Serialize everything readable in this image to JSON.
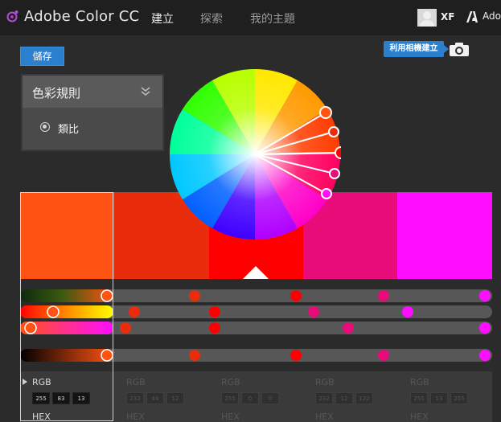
{
  "app": {
    "title": "Adobe Color CC"
  },
  "nav": {
    "create": "建立",
    "explore": "探索",
    "my_themes": "我的主題"
  },
  "user": {
    "name": "XF",
    "adobe_label": "Adobe"
  },
  "toolbar": {
    "save_label": "儲存",
    "camera_tip": "利用相機建立"
  },
  "rules": {
    "title": "色彩規則",
    "option": "類比"
  },
  "swatches": [
    {
      "color": "#FF5313",
      "rgb": [
        "255",
        "83",
        "13"
      ],
      "hex_label": "HEX",
      "rgb_label": "RGB"
    },
    {
      "color": "#E82C0C",
      "rgb": [
        "232",
        "44",
        "12"
      ],
      "hex_label": "HEX",
      "rgb_label": "RGB"
    },
    {
      "color": "#FF0000",
      "rgb": [
        "255",
        "0",
        "0"
      ],
      "hex_label": "HEX",
      "rgb_label": "RGB"
    },
    {
      "color": "#E80C7A",
      "rgb": [
        "232",
        "12",
        "122"
      ],
      "hex_label": "HEX",
      "rgb_label": "RGB"
    },
    {
      "color": "#FF0DFF",
      "rgb": [
        "255",
        "13",
        "255"
      ],
      "hex_label": "HEX",
      "rgb_label": "RGB"
    }
  ],
  "selected_swatch": 0,
  "icons": {
    "logo": "color-wheel-logo-icon",
    "camera": "camera-icon",
    "chevron": "double-chevron-down-icon",
    "expand": "triangle-right-icon",
    "adobe": "adobe-logo-icon"
  }
}
